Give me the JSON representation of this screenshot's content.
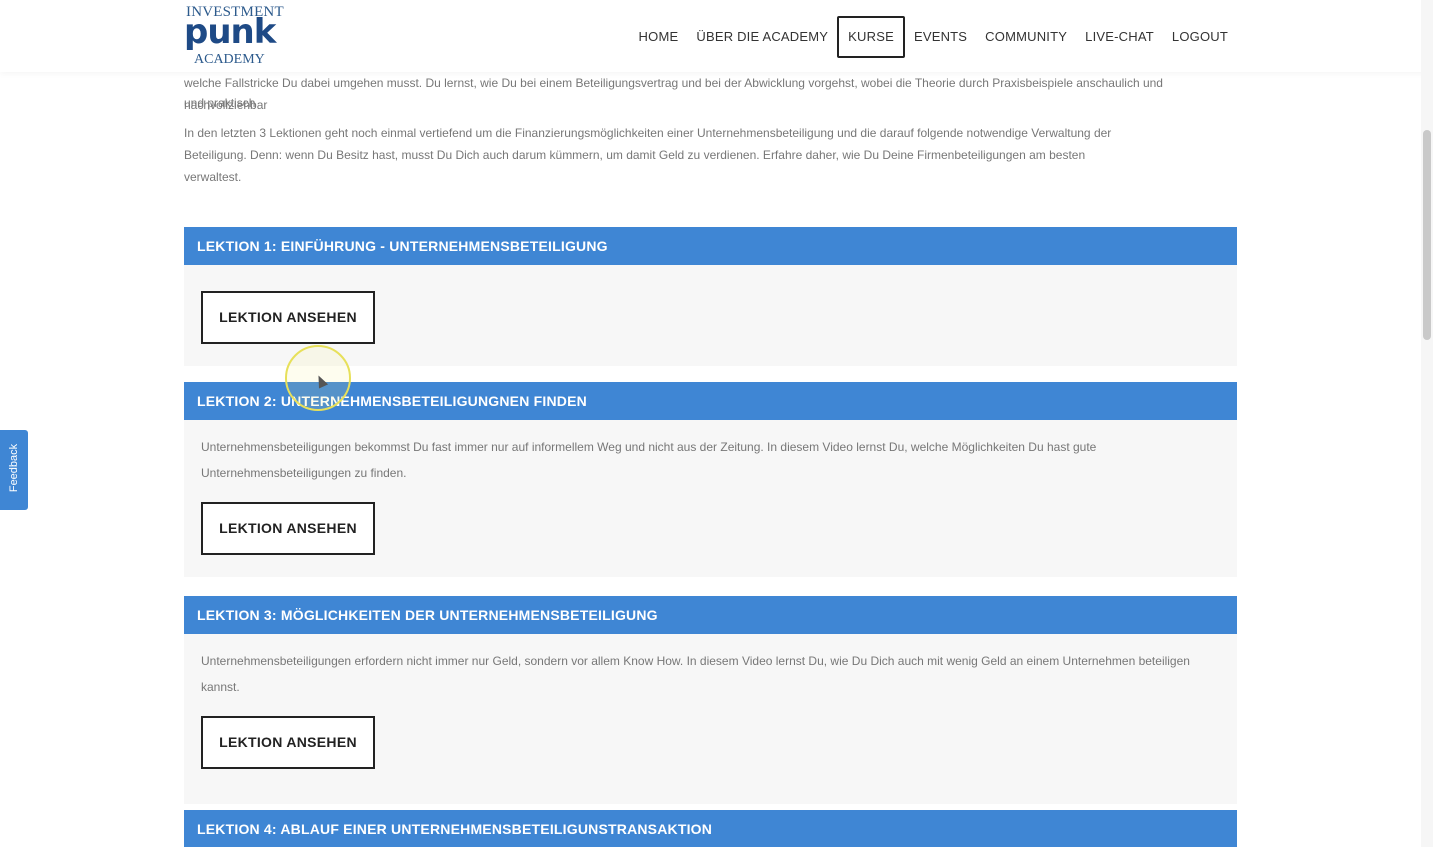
{
  "logo": {
    "top": "INVESTMENT",
    "mid": "punk",
    "bottom": "ACADEMY"
  },
  "nav": [
    {
      "label": "HOME",
      "active": false
    },
    {
      "label": "ÜBER DIE ACADEMY",
      "active": false
    },
    {
      "label": "KURSE",
      "active": true
    },
    {
      "label": "EVENTS",
      "active": false
    },
    {
      "label": "COMMUNITY",
      "active": false
    },
    {
      "label": "LIVE-CHAT",
      "active": false
    },
    {
      "label": "LOGOUT",
      "active": false
    }
  ],
  "intro": {
    "line1": "welche Fallstricke Du dabei umgehen musst. Du lernst, wie Du bei einem Beteiligungsvertrag und bei der Abwicklung vorgehst, wobei die Theorie durch Praxisbeispiele anschaulich und nachvollziehbar",
    "line2": "und praktisch",
    "p2_line1": "In den letzten 3 Lektionen geht noch einmal vertiefend um die Finanzierungsmöglichkeiten einer Unternehmensbeteiligung und die darauf folgende notwendige Verwaltung der",
    "p2_line2": "Beteiligung. Denn: wenn Du Besitz hast, musst Du Dich auch darum kümmern, um damit Geld zu verdienen. Erfahre daher, wie Du Deine Firmenbeteiligungen am besten",
    "p2_line3": "verwaltest."
  },
  "lessons": [
    {
      "title": "LEKTION 1: EINFÜHRUNG - UNTERNEHMENSBETEILIGUNG",
      "desc": "",
      "button": "LEKTION ANSEHEN"
    },
    {
      "title": "LEKTION 2: UNTERNEHMENSBETEILIGUNGNEN FINDEN",
      "desc": "Unternehmensbeteiligungen bekommst Du fast immer nur auf informellem Weg und nicht aus der Zeitung. In diesem Video lernst Du, welche Möglichkeiten Du hast gute Unternehmensbeteiligungen zu finden.",
      "button": "LEKTION ANSEHEN"
    },
    {
      "title": "LEKTION 3: MÖGLICHKEITEN DER UNTERNEHMENSBETEILIGUNG",
      "desc": "Unternehmensbeteiligungen erfordern nicht immer nur Geld, sondern vor allem Know How. In diesem Video lernst Du, wie Du Dich auch mit wenig Geld an einem Unternehmen beteiligen kannst.",
      "button": "LEKTION ANSEHEN"
    },
    {
      "title": "LEKTION 4: ABLAUF EINER UNTERNEHMENSBETEILIGUNSTRANSAKTION",
      "desc": "",
      "button": ""
    }
  ],
  "feedback": {
    "label": "Feedback"
  },
  "colors": {
    "accent": "#3f86d4",
    "text": "#777777",
    "panel": "#f7f7f7"
  }
}
